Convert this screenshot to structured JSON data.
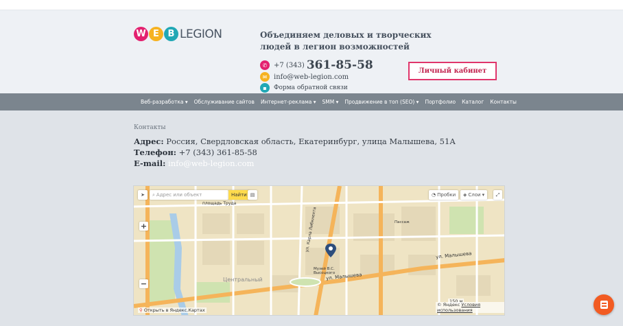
{
  "brand": {
    "logo_letters": [
      "W",
      "E",
      "B"
    ],
    "logo_word": "LEGION",
    "colors": {
      "w": "#e3216f",
      "e": "#f6b221",
      "b": "#21a8b5"
    }
  },
  "header": {
    "tagline": "Объединяем деловых и творческих людей в легион возможностей",
    "phone_code": "+7 (343)",
    "phone_number": "361-85-58",
    "email": "info@web-legion.com",
    "feedback_form": "Форма обратной связи",
    "cabinet_button": "Личный кабинет"
  },
  "nav": {
    "items": [
      "Веб-разработка ▾",
      "Обслуживание сайтов",
      "Интернет-реклама ▾",
      "SMM ▾",
      "Продвижение в топ (SEO) ▾",
      "Портфолио",
      "Каталог",
      "Контакты"
    ]
  },
  "content": {
    "breadcrumb": "Контакты",
    "address_label": "Адрес:",
    "address_value": "Россия, Свердловская область, Екатеринбург, улица Малышева, 51А",
    "phone_label": "Телефон:",
    "phone_value": "+7 (343) 361-85-58",
    "email_label": "E-mail:",
    "email_value": "info@web-legion.com"
  },
  "map": {
    "search_placeholder": "Адрес или объект",
    "search_button": "Найти",
    "traffic_button": "Пробки",
    "layers_button": "Слои",
    "open_in_yandex": "Открыть в Яндекс.Картах",
    "copyright": "© Яндекс",
    "terms_link": "Условия использования",
    "scale_label": "150 м",
    "labels": {
      "square": "площадь Труда",
      "street_malysheva": "ул. Малышева",
      "street_malysheva2": "ул. Малышева",
      "street_karla": "ул. Карла Либкнехта",
      "district": "Центральный",
      "museum": "Музей В.С. Высоцкого",
      "trade": "Пассаж"
    }
  }
}
